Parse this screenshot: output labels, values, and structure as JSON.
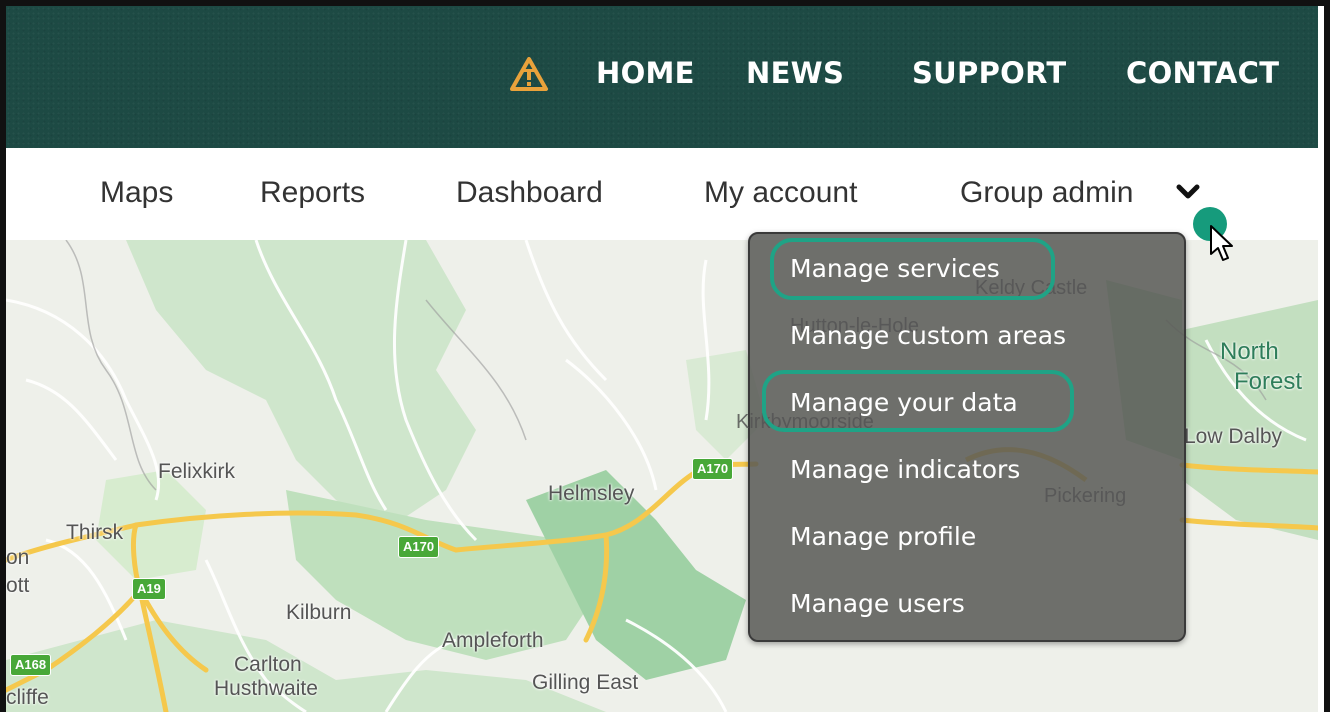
{
  "top_nav": {
    "warning_icon": "warning-triangle-icon",
    "items": [
      "HOME",
      "NEWS",
      "SUPPORT",
      "CONTACT"
    ]
  },
  "sub_nav": {
    "items": [
      "Maps",
      "Reports",
      "Dashboard",
      "My account",
      "Group admin"
    ],
    "dropdown_icon": "chevron-down-icon"
  },
  "dropdown": {
    "items": [
      "Manage services",
      "Manage custom areas",
      "Manage your data",
      "Manage indicators",
      "Manage profile",
      "Manage users"
    ],
    "highlighted": [
      "Manage services",
      "Manage your data"
    ]
  },
  "map": {
    "places": [
      "Keldy Castle",
      "Hutton-le-Hole",
      "North",
      "Forest",
      "Kirkbymoorside",
      "Low Dalby",
      "Felixkirk",
      "Helmsley",
      "Pickering",
      "Thirsk",
      "on",
      "ott",
      "Kilburn",
      "Ampleforth",
      "Carlton",
      "Husthwaite",
      "Gilling East",
      "cliffe"
    ],
    "roads": [
      "A170",
      "A170",
      "A19",
      "A168"
    ]
  },
  "colors": {
    "header_bg": "#1d4a44",
    "highlight": "#1fa386",
    "warning": "#e9a23b",
    "road_badge": "#48a838"
  }
}
